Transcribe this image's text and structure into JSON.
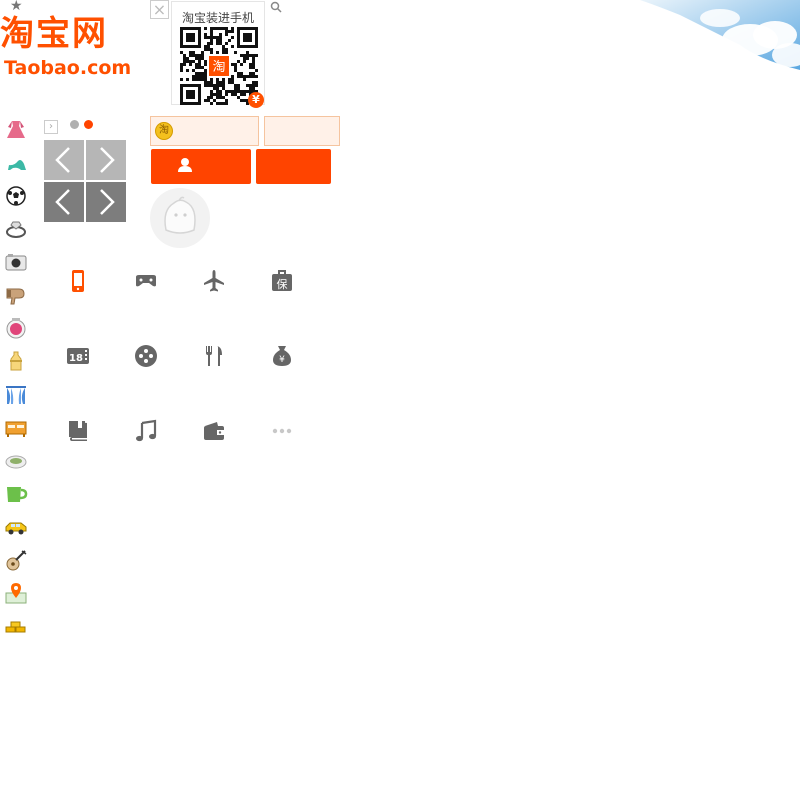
{
  "logo": {
    "cn": "淘宝网",
    "en": "Taobao.com"
  },
  "qr": {
    "caption": "淘宝装进手机",
    "badge": "¥",
    "center_mark": "淘"
  },
  "login": {
    "coin_mark": "淘"
  },
  "categories": [
    "dress-icon",
    "high-heel-icon",
    "soccer-ball-icon",
    "ring-icon",
    "camera-icon",
    "hair-dryer-icon",
    "makeup-icon",
    "baby-bottle-icon",
    "curtain-icon",
    "furniture-icon",
    "food-icon",
    "cup-icon",
    "car-icon",
    "guitar-icon",
    "map-pin-icon",
    "gold-bars-icon"
  ],
  "services": [
    "mobile-phone-icon",
    "game-controller-icon",
    "airplane-icon",
    "insurance-icon",
    "movie-18-icon",
    "gamepad-icon",
    "restaurant-icon",
    "money-bag-icon",
    "book-icon",
    "music-icon",
    "wallet-icon",
    "more-icon"
  ],
  "colors": {
    "brand": "#ff5000",
    "button": "#ff4400",
    "nav_gray_light": "#b6b6b6",
    "nav_gray_dark": "#7d7d7d",
    "icon_gray": "#666666"
  }
}
